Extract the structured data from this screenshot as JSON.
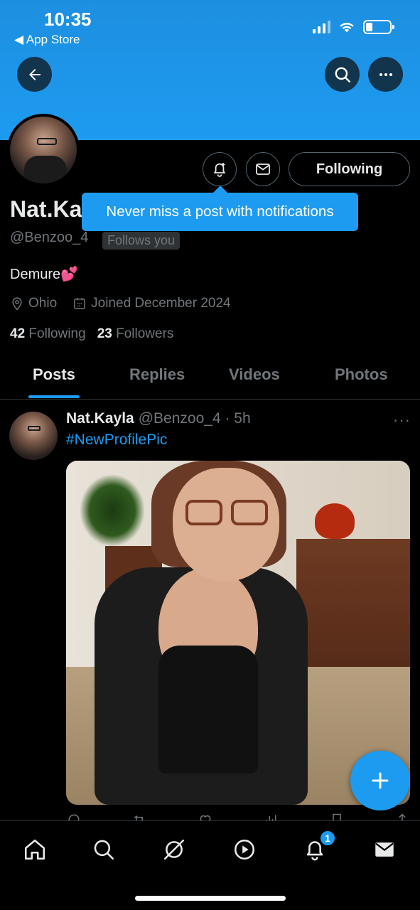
{
  "status_bar": {
    "time": "10:35",
    "back_label": "◀ App Store"
  },
  "profile": {
    "display_name": "Nat.Ka",
    "handle": "@Benzoo_4",
    "follows_you": "Follows you",
    "bio": "Demure💕",
    "location": "Ohio",
    "joined": "Joined December 2024",
    "following_count": "42",
    "following_label": "Following",
    "followers_count": "23",
    "followers_label": "Followers",
    "follow_button": "Following"
  },
  "tooltip": {
    "text": "Never miss a post with notifications"
  },
  "tabs": [
    {
      "label": "Posts"
    },
    {
      "label": "Replies"
    },
    {
      "label": "Videos"
    },
    {
      "label": "Photos"
    }
  ],
  "post": {
    "name": "Nat.Kayla",
    "meta": "@Benzoo_4 · 5h",
    "text": "#NewProfilePic",
    "more": "···"
  },
  "bottom_nav": {
    "items": [
      "home-icon",
      "search-icon",
      "grok-icon",
      "video-icon",
      "notifications-icon",
      "messages-icon"
    ],
    "notification_badge": "1"
  },
  "colors": {
    "accent": "#1d9bf0",
    "background": "#000000",
    "muted": "#71767b"
  }
}
